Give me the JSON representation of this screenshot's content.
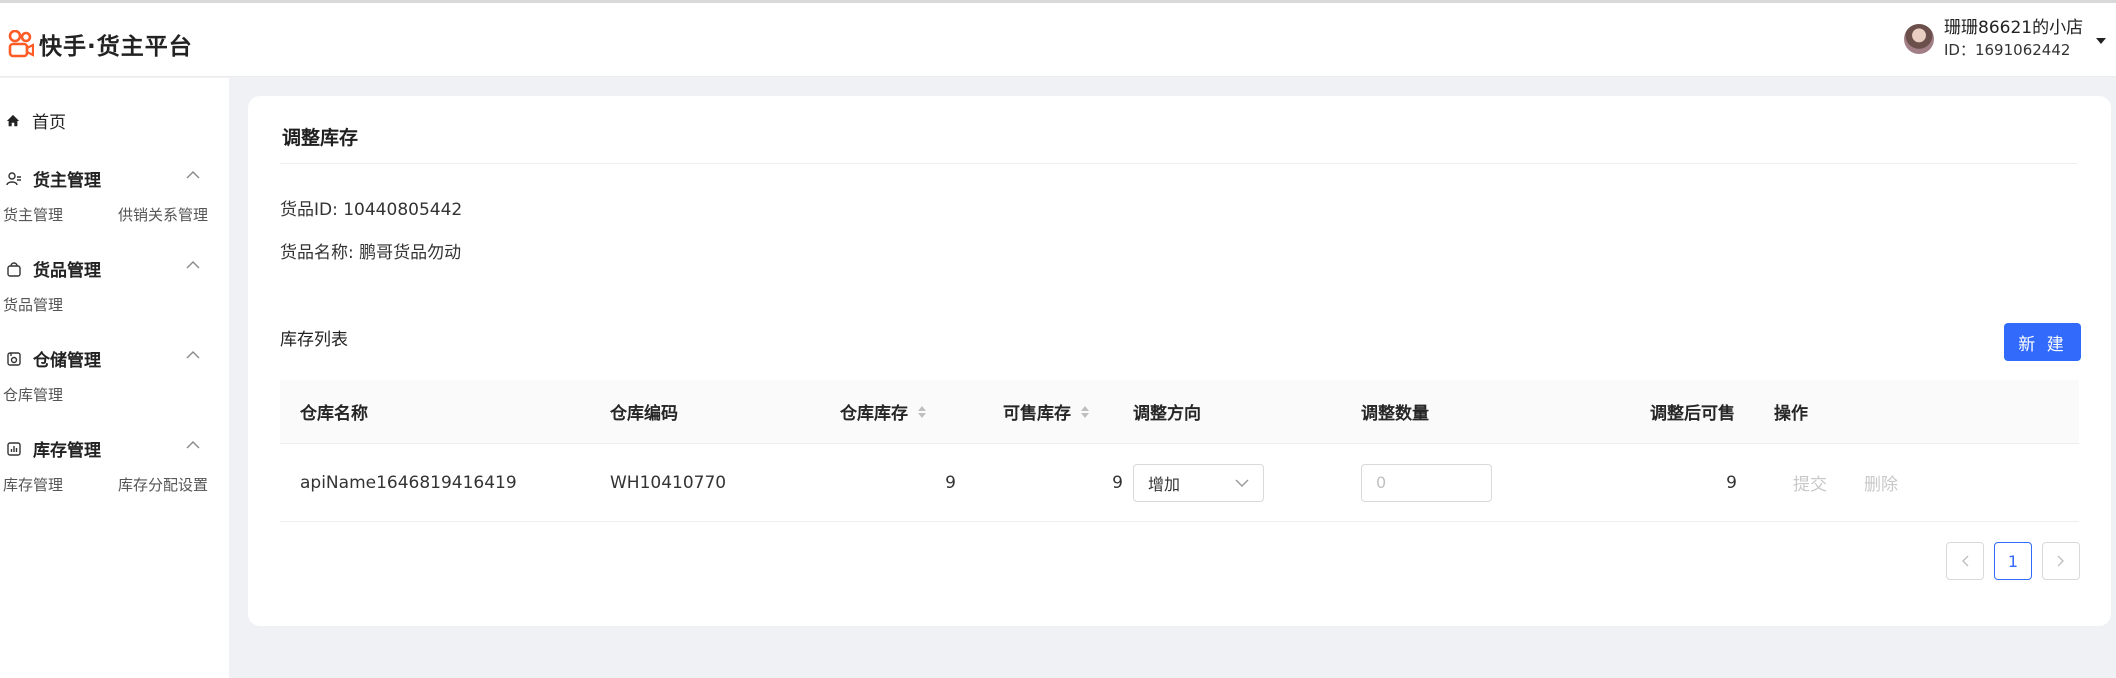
{
  "header": {
    "app_title": "快手·货主平台",
    "user_name": "珊珊86621的小店",
    "user_id": "ID：1691062442"
  },
  "sidebar": {
    "home": "首页",
    "groups": [
      {
        "title": "货主管理",
        "items": [
          "货主管理",
          "供销关系管理"
        ]
      },
      {
        "title": "货品管理",
        "items": [
          "货品管理"
        ]
      },
      {
        "title": "仓储管理",
        "items": [
          "仓库管理"
        ]
      },
      {
        "title": "库存管理",
        "items": [
          "库存管理",
          "库存分配设置"
        ]
      }
    ]
  },
  "page": {
    "title": "调整库存",
    "goods_id": "货品ID: 10440805442",
    "goods_name": "货品名称: 鹏哥货品勿动",
    "list_title": "库存列表",
    "new_button": "新 建"
  },
  "table": {
    "columns": [
      "仓库名称",
      "仓库编码",
      "仓库库存",
      "可售库存",
      "调整方向",
      "调整数量",
      "调整后可售",
      "操作"
    ],
    "rows": [
      {
        "warehouse_name": "apiName1646819416419",
        "warehouse_code": "WH10410770",
        "warehouse_stock": "9",
        "sellable_stock": "9",
        "direction": "增加",
        "quantity_placeholder": "0",
        "after_sellable": "9",
        "action_submit": "提交",
        "action_delete": "删除"
      }
    ]
  },
  "pagination": {
    "prev": "<",
    "current_page": "1",
    "next": ">"
  },
  "colors": {
    "accent": "#326bfb",
    "brand": "#fe3666"
  }
}
